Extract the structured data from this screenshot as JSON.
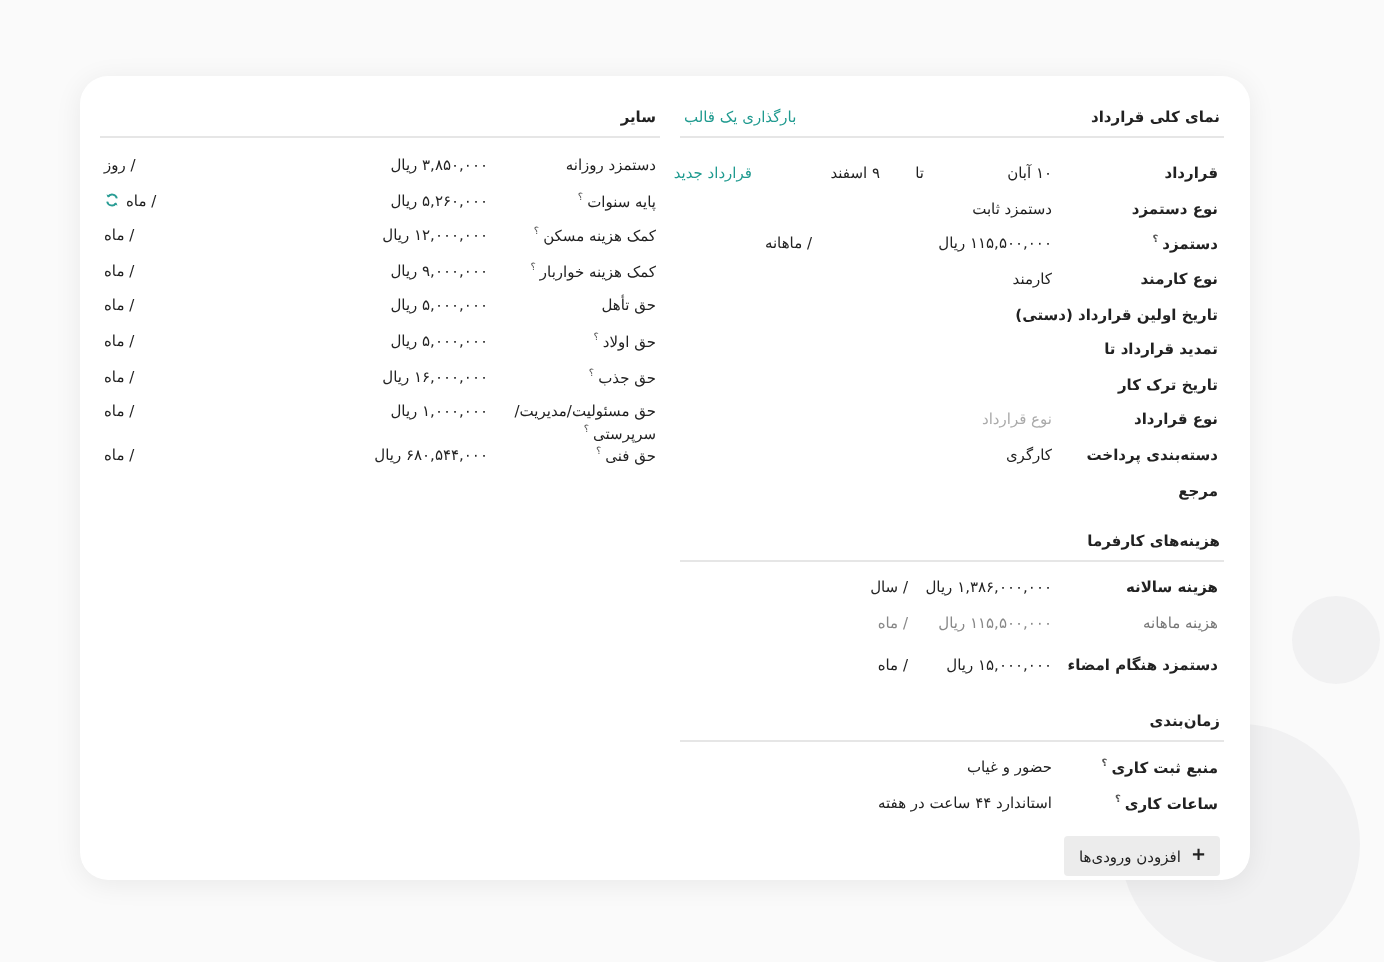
{
  "contract": {
    "title": "نمای کلی قرارداد",
    "link": "بارگذاری یک قالب",
    "fields": [
      {
        "kind": "contract",
        "label": "قرارداد",
        "start": "۱۰ آبان",
        "sep": "تا",
        "end": "۹ اسفند",
        "action": "قرارداد جدید"
      },
      {
        "kind": "text",
        "label": "نوع دستمزد",
        "value": "دستمزد ثابت"
      },
      {
        "kind": "amount",
        "label": "دستمزد",
        "help": "؟",
        "value": "۱۱۵,۵۰۰,۰۰۰ ریال",
        "unit": "/  ماهانه"
      },
      {
        "kind": "text",
        "label": "نوع کارمند",
        "value": "کارمند"
      },
      {
        "kind": "text",
        "label": "تاریخ اولین قرارداد (دستی)"
      },
      {
        "kind": "text",
        "label": "تمدید قرارداد تا"
      },
      {
        "kind": "text",
        "label": "تاریخ ترک کار"
      },
      {
        "kind": "text",
        "label": "نوع قرارداد",
        "placeholder": "نوع قرارداد"
      },
      {
        "kind": "text",
        "label": "دسته‌بندی پرداخت",
        "value": "کارگری"
      },
      {
        "kind": "text",
        "label": "مرجع"
      }
    ]
  },
  "other": {
    "title": "سایر",
    "rows": [
      {
        "label": "دستمزد روزانه",
        "value": "۳,۸۵۰,۰۰۰ ریال",
        "unit": "/ روز",
        "refresh": false
      },
      {
        "label": "پایه سنوات",
        "help": "؟",
        "value": "۵,۲۶۰,۰۰۰ ریال",
        "unit": "/ ماه",
        "refresh": true
      },
      {
        "label": "کمک هزینه مسکن",
        "help": "؟",
        "value": "۱۲,۰۰۰,۰۰۰ ریال",
        "unit": "/ ماه",
        "refresh": false
      },
      {
        "label": "کمک هزینه خواربار",
        "help": "؟",
        "value": "۹,۰۰۰,۰۰۰ ریال",
        "unit": "/ ماه",
        "refresh": false
      },
      {
        "label": "حق تأهل",
        "value": "۵,۰۰۰,۰۰۰ ریال",
        "unit": "/ ماه",
        "refresh": false
      },
      {
        "label": "حق اولاد",
        "help": "؟",
        "value": "۵,۰۰۰,۰۰۰ ریال",
        "unit": "/ ماه",
        "refresh": false
      },
      {
        "label": "حق جذب",
        "help": "؟",
        "value": "۱۶,۰۰۰,۰۰۰ ریال",
        "unit": "/ ماه",
        "refresh": false
      },
      {
        "label": "حق مسئولیت/مدیریت/سرپرستی",
        "help": "؟",
        "value": "۱,۰۰۰,۰۰۰ ریال",
        "unit": "/ ماه",
        "refresh": false
      },
      {
        "label": "حق فنی",
        "help": "؟",
        "value": "۶۸۰,۵۴۴,۰۰۰ ریال",
        "unit": "/ ماه",
        "refresh": false
      }
    ]
  },
  "employer": {
    "title": "هزینه‌های کارفرما",
    "rows": [
      {
        "label": "هزینه سالانه",
        "value": "۱,۳۸۶,۰۰۰,۰۰۰ ریال",
        "unit": "/ سال",
        "muted": false
      },
      {
        "label": "هزینه ماهانه",
        "value": "۱۱۵,۵۰۰,۰۰۰ ریال",
        "unit": "/ ماه",
        "muted": true
      },
      {
        "label": "دستمزد هنگام امضاء",
        "value": "۱۵,۰۰۰,۰۰۰ ریال",
        "unit": "/ ماه",
        "muted": false
      }
    ]
  },
  "schedule": {
    "title": "زمان‌بندی",
    "rows": [
      {
        "label": "منبع ثبت کاری",
        "help": "؟",
        "value": "حضور و غیاب"
      },
      {
        "label": "ساعات کاری",
        "help": "؟",
        "value": "استاندارد ۴۴ ساعت در هفته"
      }
    ]
  },
  "add_button": {
    "icon": "+",
    "label": "افزودن ورودی‌ها"
  }
}
